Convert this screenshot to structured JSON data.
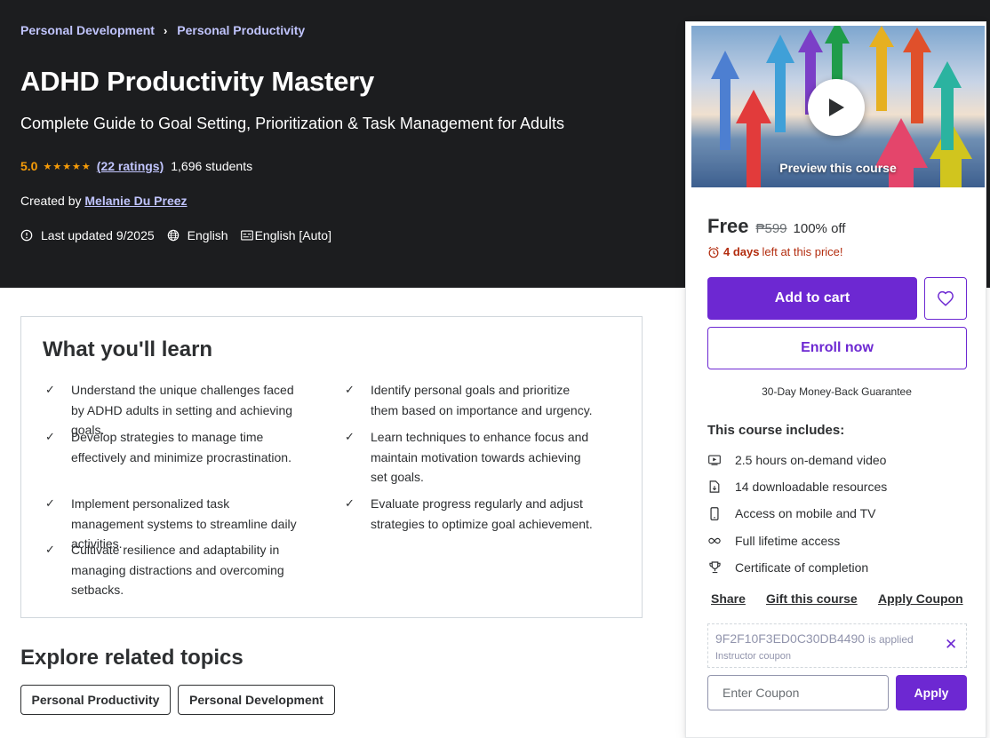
{
  "breadcrumb": {
    "items": [
      "Personal Development",
      "Personal Productivity"
    ],
    "separator": "›"
  },
  "course": {
    "title": "ADHD Productivity Mastery",
    "subtitle": "Complete Guide to Goal Setting, Prioritization & Task Management for Adults",
    "rating": "5.0",
    "stars": 5,
    "ratings_link": "(22 ratings)",
    "students": "1,696 students",
    "created_by_label": "Created by",
    "instructor": "Melanie Du Preez",
    "last_updated": "Last updated 9/2025",
    "language": "English",
    "captions": "English [Auto]"
  },
  "learn": {
    "title": "What you'll learn",
    "items": [
      "Understand the unique challenges faced by ADHD adults in setting and achieving goals.",
      "Identify personal goals and prioritize them based on importance and urgency.",
      "Develop strategies to manage time effectively and minimize procrastination.",
      "Learn techniques to enhance focus and maintain motivation towards achieving set goals.",
      "Implement personalized task management systems to streamline daily activities.",
      "Evaluate progress regularly and adjust strategies to optimize goal achievement.",
      "Cultivate resilience and adaptability in managing distractions and overcoming setbacks."
    ]
  },
  "related": {
    "title": "Explore related topics",
    "topics": [
      "Personal Productivity",
      "Personal Development"
    ]
  },
  "sidebar": {
    "preview_label": "Preview this course",
    "price": "Free",
    "original_price": "₱599",
    "discount": "100% off",
    "timer_bold": "4 days",
    "timer_rest": "left at this price!",
    "add_to_cart": "Add to cart",
    "enroll": "Enroll now",
    "guarantee": "30-Day Money-Back Guarantee",
    "includes_title": "This course includes:",
    "includes": [
      "2.5 hours on-demand video",
      "14 downloadable resources",
      "Access on mobile and TV",
      "Full lifetime access",
      "Certificate of completion"
    ],
    "links": [
      "Share",
      "Gift this course",
      "Apply Coupon"
    ],
    "coupon_code": "9F2F10F3ED0C30DB4490",
    "coupon_applied": "is applied",
    "coupon_type": "Instructor coupon",
    "coupon_placeholder": "Enter Coupon",
    "apply_label": "Apply"
  },
  "colors": {
    "hero_bg": "#1c1d1f",
    "accent": "#6d28d2",
    "link_light": "#c0c4fc",
    "star": "#f69c08",
    "alert": "#b32d0f"
  }
}
